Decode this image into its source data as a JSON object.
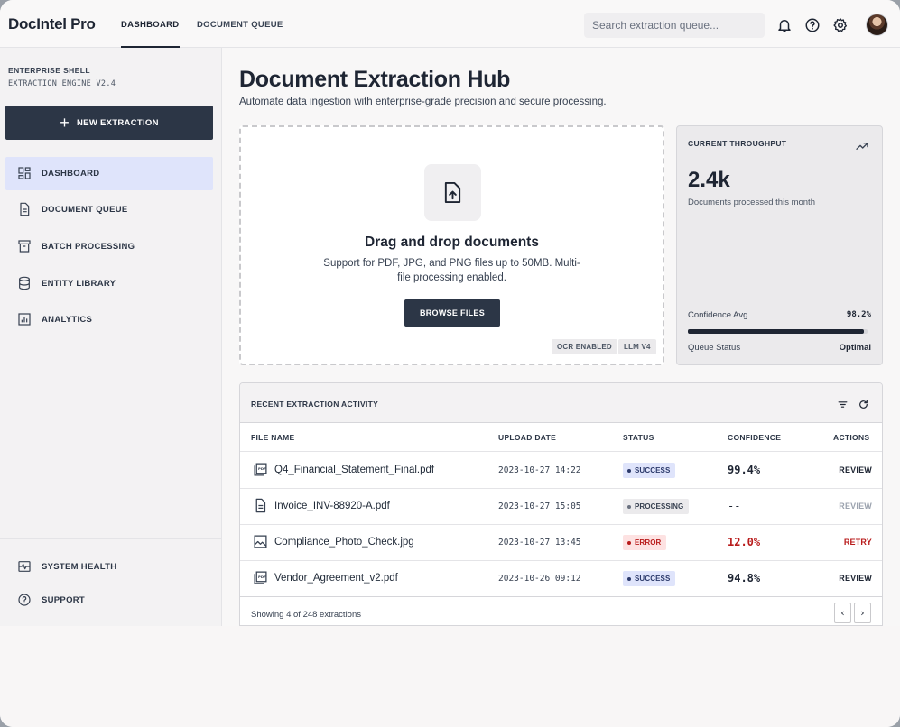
{
  "app": {
    "brand": "DocIntel Pro"
  },
  "topnav": {
    "tabs": [
      {
        "label": "DASHBOARD",
        "active": true
      },
      {
        "label": "DOCUMENT QUEUE",
        "active": false
      }
    ]
  },
  "search": {
    "placeholder": "Search extraction queue..."
  },
  "topbar_icons": [
    "bell-icon",
    "help-icon",
    "gear-icon",
    "user-avatar"
  ],
  "sidebar": {
    "shell_title": "ENTERPRISE SHELL",
    "shell_subtitle": "EXTRACTION ENGINE V2.4",
    "new_button": "NEW EXTRACTION",
    "items": [
      {
        "label": "DASHBOARD",
        "icon": "dashboard-icon",
        "active": true
      },
      {
        "label": "DOCUMENT QUEUE",
        "icon": "document-icon",
        "active": false
      },
      {
        "label": "BATCH PROCESSING",
        "icon": "archive-icon",
        "active": false
      },
      {
        "label": "ENTITY LIBRARY",
        "icon": "database-icon",
        "active": false
      },
      {
        "label": "ANALYTICS",
        "icon": "analytics-icon",
        "active": false
      }
    ],
    "footer_items": [
      {
        "label": "SYSTEM HEALTH",
        "icon": "health-icon"
      },
      {
        "label": "SUPPORT",
        "icon": "support-icon"
      }
    ]
  },
  "main": {
    "title": "Document Extraction Hub",
    "subtitle": "Automate data ingestion with enterprise-grade precision and secure processing."
  },
  "upload": {
    "title": "Drag and drop documents",
    "description": "Support for PDF, JPG, and PNG files up to 50MB. Multi-file processing enabled.",
    "button": "BROWSE FILES",
    "chips": [
      "OCR ENABLED",
      "LLM V4"
    ]
  },
  "throughput": {
    "title": "CURRENT THROUGHPUT",
    "value": "2.4k",
    "description": "Documents processed this month",
    "confidence_label": "Confidence Avg",
    "confidence_value": "98.2%",
    "confidence_fraction": 0.982,
    "queue_label": "Queue Status",
    "queue_value": "Optimal"
  },
  "activity": {
    "title": "RECENT EXTRACTION ACTIVITY",
    "columns": [
      "FILE NAME",
      "UPLOAD DATE",
      "STATUS",
      "CONFIDENCE",
      "ACTIONS"
    ],
    "rows": [
      {
        "file": "Q4_Financial_Statement_Final.pdf",
        "icon": "pdf-icon",
        "date": "2023-10-27 14:22",
        "status": "SUCCESS",
        "confidence": "99.4%",
        "action": "REVIEW"
      },
      {
        "file": "Invoice_INV-88920-A.pdf",
        "icon": "document-icon",
        "date": "2023-10-27 15:05",
        "status": "PROCESSING",
        "confidence": "--",
        "action": "REVIEW"
      },
      {
        "file": "Compliance_Photo_Check.jpg",
        "icon": "image-icon",
        "date": "2023-10-27 13:45",
        "status": "ERROR",
        "confidence": "12.0%",
        "action": "RETRY"
      },
      {
        "file": "Vendor_Agreement_v2.pdf",
        "icon": "pdf-icon",
        "date": "2023-10-26 09:12",
        "status": "SUCCESS",
        "confidence": "94.8%",
        "action": "REVIEW"
      }
    ],
    "footer": "Showing 4 of 248 extractions",
    "prev": "‹",
    "next": "›"
  },
  "colors": {
    "primary": "#2c3646",
    "active_nav_bg": "#dfe4fb",
    "success_bg": "#dfe4fb",
    "success_text": "#2c3a6b",
    "processing_bg": "#ebeaec",
    "error_bg": "#fde2e2",
    "error_text": "#b91c1c"
  }
}
